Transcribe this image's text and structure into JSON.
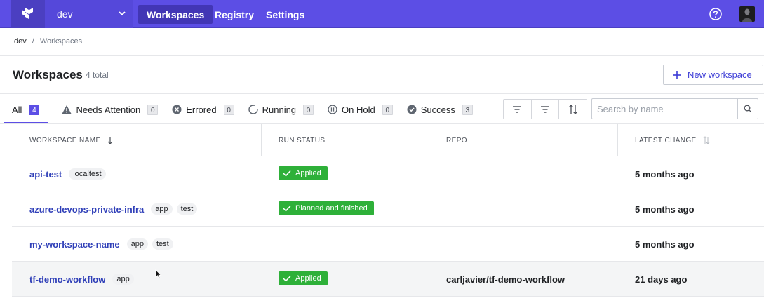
{
  "nav": {
    "org": "dev",
    "items": [
      {
        "label": "Workspaces",
        "active": true
      },
      {
        "label": "Registry",
        "active": false
      },
      {
        "label": "Settings",
        "active": false
      }
    ]
  },
  "breadcrumb": {
    "org": "dev",
    "separator": "/",
    "current": "Workspaces"
  },
  "page": {
    "title": "Workspaces",
    "count": "4 total",
    "new_button": "New workspace"
  },
  "tabs": [
    {
      "label": "All",
      "count": "4",
      "icon": "none",
      "active": true
    },
    {
      "label": "Needs Attention",
      "count": "0",
      "icon": "warning-icon"
    },
    {
      "label": "Errored",
      "count": "0",
      "icon": "error-icon"
    },
    {
      "label": "Running",
      "count": "0",
      "icon": "running-icon"
    },
    {
      "label": "On Hold",
      "count": "0",
      "icon": "pause-icon"
    },
    {
      "label": "Success",
      "count": "3",
      "icon": "check-circle-icon"
    }
  ],
  "search": {
    "placeholder": "Search by name",
    "value": ""
  },
  "table": {
    "columns": {
      "name": "WORKSPACE NAME",
      "status": "RUN STATUS",
      "repo": "REPO",
      "changed": "LATEST CHANGE"
    },
    "rows": [
      {
        "name": "api-test",
        "tags": [
          "localtest"
        ],
        "status": "Applied",
        "repo": "",
        "changed": "5 months ago"
      },
      {
        "name": "azure-devops-private-infra",
        "tags": [
          "app",
          "test"
        ],
        "status": "Planned and finished",
        "repo": "",
        "changed": "5 months ago"
      },
      {
        "name": "my-workspace-name",
        "tags": [
          "app",
          "test"
        ],
        "status": "",
        "repo": "",
        "changed": "5 months ago"
      },
      {
        "name": "tf-demo-workflow",
        "tags": [
          "app"
        ],
        "status": "Applied",
        "repo": "carljavier/tf-demo-workflow",
        "changed": "21 days ago"
      }
    ]
  },
  "colors": {
    "brand": "#5c4ee5",
    "status_green": "#2eb039",
    "link": "#2f3fb8"
  }
}
